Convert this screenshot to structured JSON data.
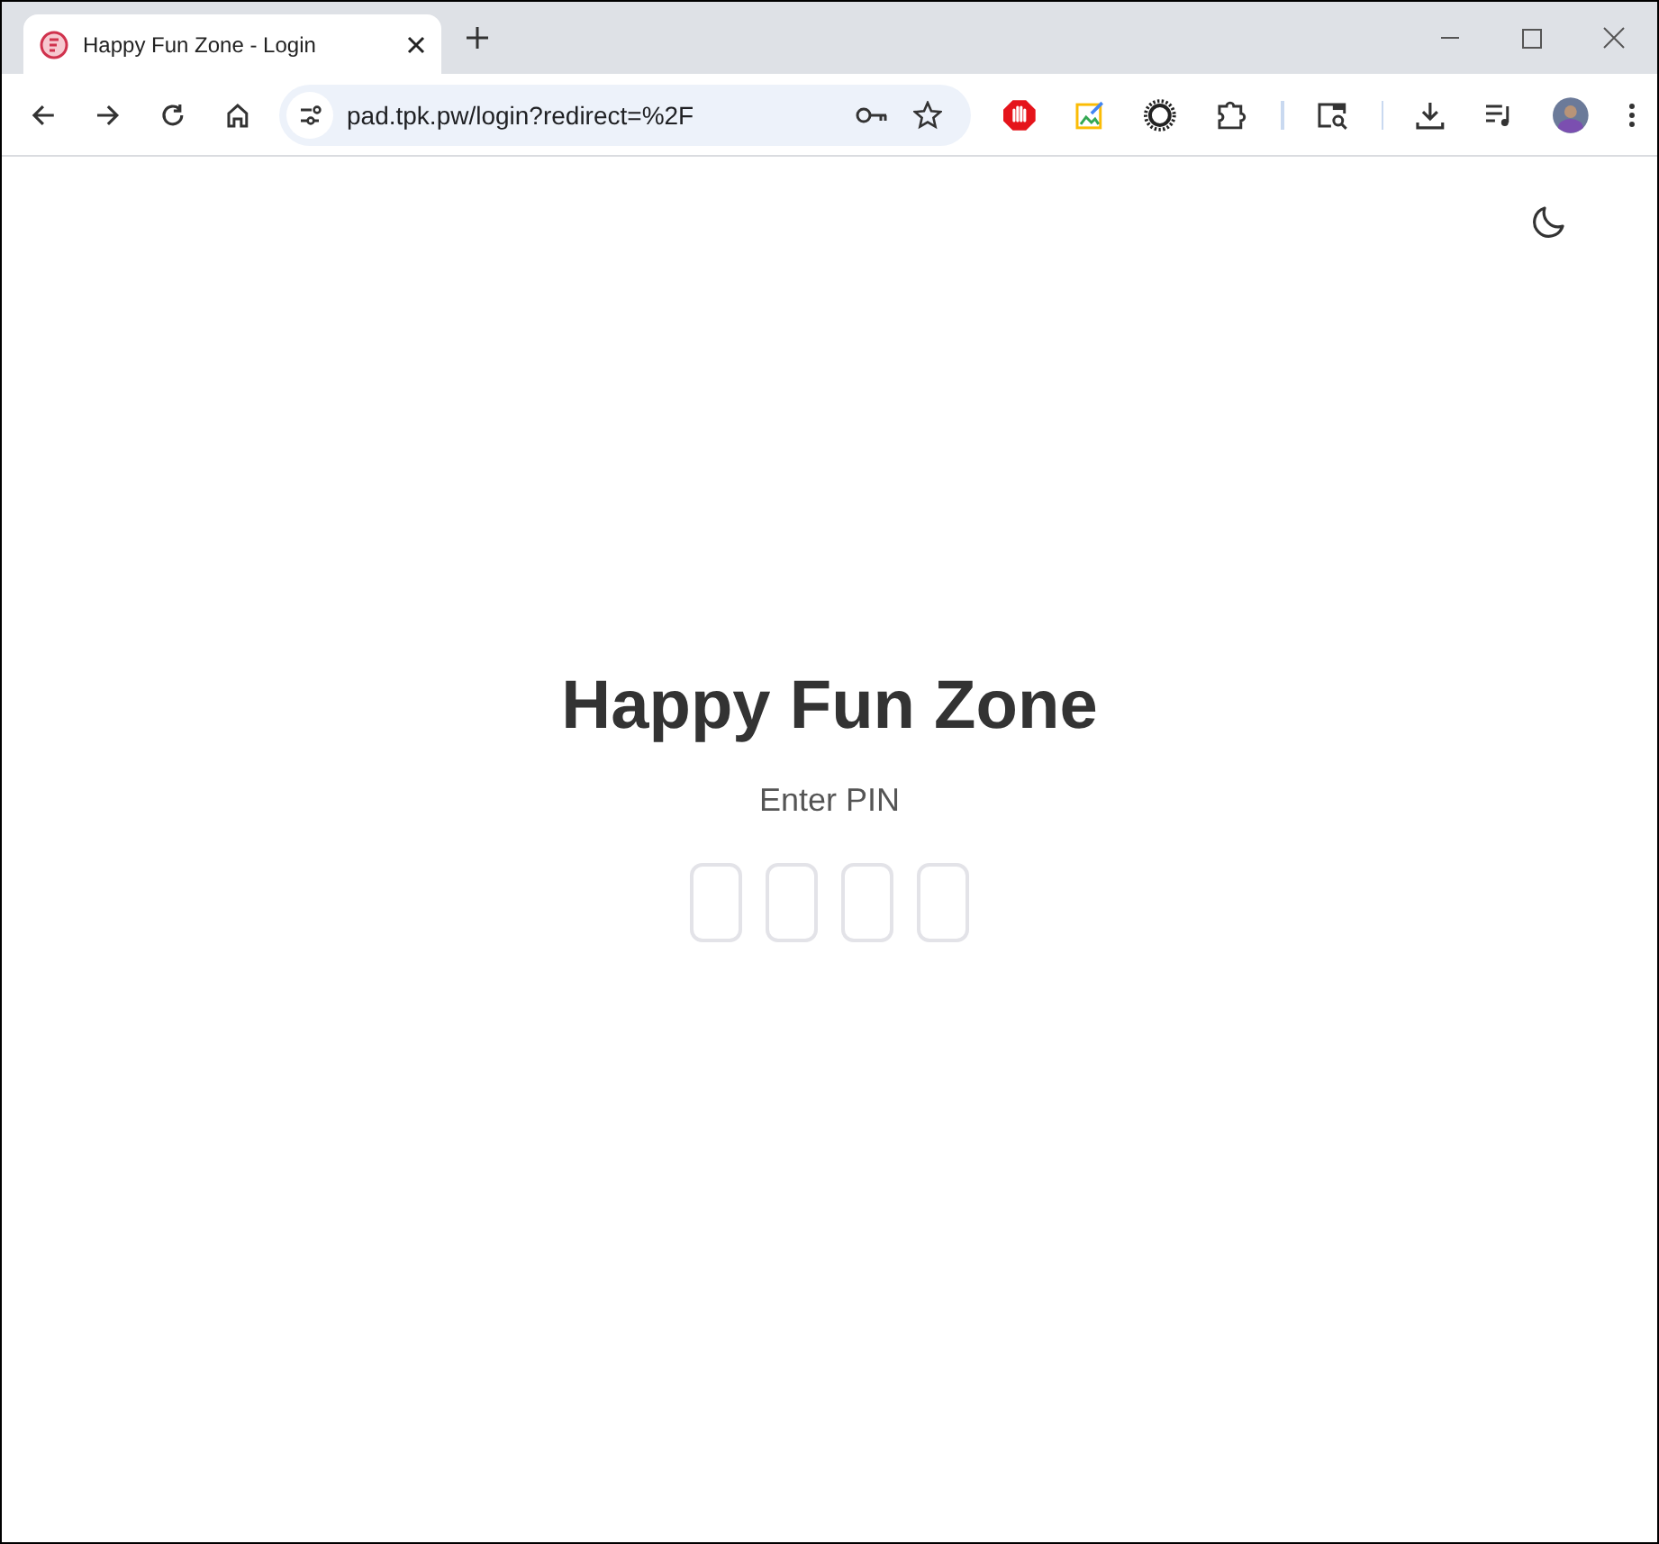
{
  "browser": {
    "tab": {
      "title": "Happy Fun Zone - Login",
      "selected": true
    },
    "address": "pad.tpk.pw/login?redirect=%2F"
  },
  "page": {
    "title": "Happy Fun Zone",
    "subtitle": "Enter PIN",
    "pin_fields": [
      {
        "kind": "digit"
      },
      {
        "kind": "digit"
      },
      {
        "kind": "digit"
      },
      {
        "kind": "digit"
      }
    ]
  }
}
